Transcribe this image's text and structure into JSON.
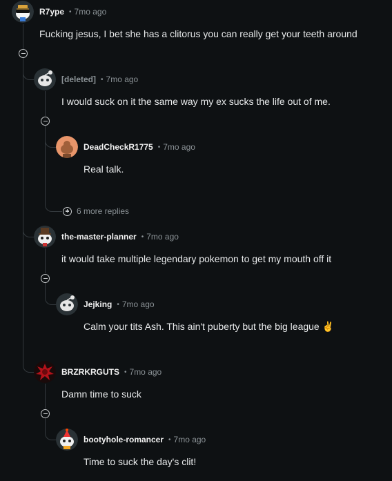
{
  "comments": [
    {
      "author": "R7ype",
      "time": "7mo ago",
      "body": "Fucking jesus, I bet she has a clitorus you can really get your teeth around"
    },
    {
      "author": "[deleted]",
      "time": "7mo ago",
      "body": "I would suck on it the same way my ex sucks the life out of me."
    },
    {
      "author": "DeadCheckR1775",
      "time": "7mo ago",
      "body": "Real talk."
    },
    {
      "author": "the-master-planner",
      "time": "7mo ago",
      "body": "it would take multiple legendary pokemon to get my mouth off it"
    },
    {
      "author": "Jejking",
      "time": "7mo ago",
      "body": "Calm your tits Ash. This ain't puberty but the big league ✌️"
    },
    {
      "author": "BRZRKRGUTS",
      "time": "7mo ago",
      "body": "Damn time to suck"
    },
    {
      "author": "bootyhole-romancer",
      "time": "7mo ago",
      "body": "Time to suck the day's clit!"
    }
  ],
  "more_replies": {
    "label": "6 more replies"
  },
  "separator": "•",
  "icons": {
    "avatar_r7ype": "sunglasses-snoo-avatar-icon",
    "avatar_deleted": "default-snoo-avatar-icon",
    "avatar_deadcheck": "orange-snoo-avatar-icon",
    "collapse": "collapse-minus-icon",
    "expand": "expand-plus-icon"
  },
  "colors": {
    "background": "#0e1113",
    "thread_line": "#343a3e",
    "meta": "#8b9296",
    "text": "#e8eaeb"
  }
}
